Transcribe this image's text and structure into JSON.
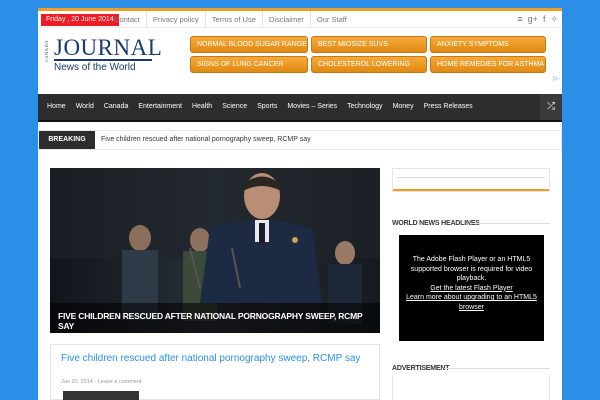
{
  "topbar": {
    "date": "Friday , 20 June 2014",
    "links": [
      "Contact",
      "Privacy policy",
      "Terms of Use",
      "Disclaimer",
      "Our Staff"
    ],
    "social_icons": [
      "rss-icon",
      "google-plus-icon",
      "facebook-icon",
      "twitter-icon"
    ]
  },
  "logo": {
    "side": "CANADA",
    "title": "JOURNAL",
    "subtitle": "News of the World"
  },
  "ads": [
    "NORMAL BLOOD SUGAR RANGE",
    "BEST MIOSIZE SUVS",
    "ANXIETY SYMPTOMS",
    "SIGNS OF LUNG CANCER",
    "CHOLESTEROL LOWERING",
    "HOME REMEDIES FOR ASTHMA"
  ],
  "adchoice": "▷",
  "nav": {
    "items": [
      "Home",
      "World",
      "Canada",
      "Entertainment",
      "Health",
      "Science",
      "Sports",
      "Movies – Series",
      "Technology",
      "Money",
      "Press Releases"
    ],
    "shuffle_icon": "shuffle-icon"
  },
  "breaking": {
    "label": "BREAKING NEWS",
    "text": "Five children rescued after national pornography sweep, RCMP say"
  },
  "hero": {
    "caption": "FIVE CHILDREN RESCUED AFTER NATIONAL PORNOGRAPHY SWEEP, RCMP SAY"
  },
  "post": {
    "title": "Five children rescued after national pornography sweep, RCMP say",
    "date": "Jun 20, 2014",
    "comments": "Leave a comment"
  },
  "sidebar": {
    "headlines_title": "WORLD NEWS HEADLINES",
    "flash_line1": "The Adobe Flash Player or an HTML5 supported browser is required for video playback.",
    "flash_link1": "Get the latest Flash Player",
    "flash_link2": "Learn more about upgrading to an HTML5 browser",
    "advert_title": "ADVERTISEMENT"
  },
  "colors": {
    "background": "#2b8fe8",
    "accent": "#f19d24",
    "nav": "#2d2d2d",
    "date_badge": "#ee1c24"
  }
}
